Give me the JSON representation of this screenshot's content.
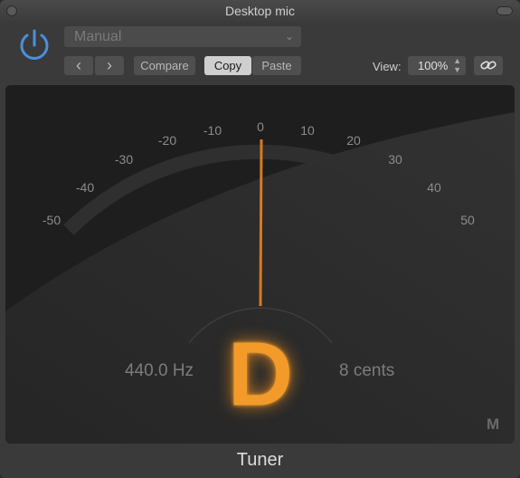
{
  "window": {
    "title": "Desktop mic"
  },
  "toolbar": {
    "preset_value": "Manual",
    "prev_label": "‹",
    "next_label": "›",
    "compare_label": "Compare",
    "copy_label": "Copy",
    "paste_label": "Paste",
    "view_label": "View:",
    "zoom_value": "100%",
    "icons": {
      "power": "power-icon",
      "link": "link-icon",
      "dropdown": "chevron-down-icon"
    }
  },
  "tuner": {
    "scale_labels": [
      "-50",
      "-40",
      "-30",
      "-20",
      "-10",
      "0",
      "10",
      "20",
      "30",
      "40",
      "50"
    ],
    "frequency": "440.0 Hz",
    "note": "D",
    "cents_readout": "8 cents",
    "mode_label": "M",
    "accent_color": "#f39b2a",
    "power_color": "#4a90d9"
  },
  "footer": {
    "title": "Tuner"
  }
}
